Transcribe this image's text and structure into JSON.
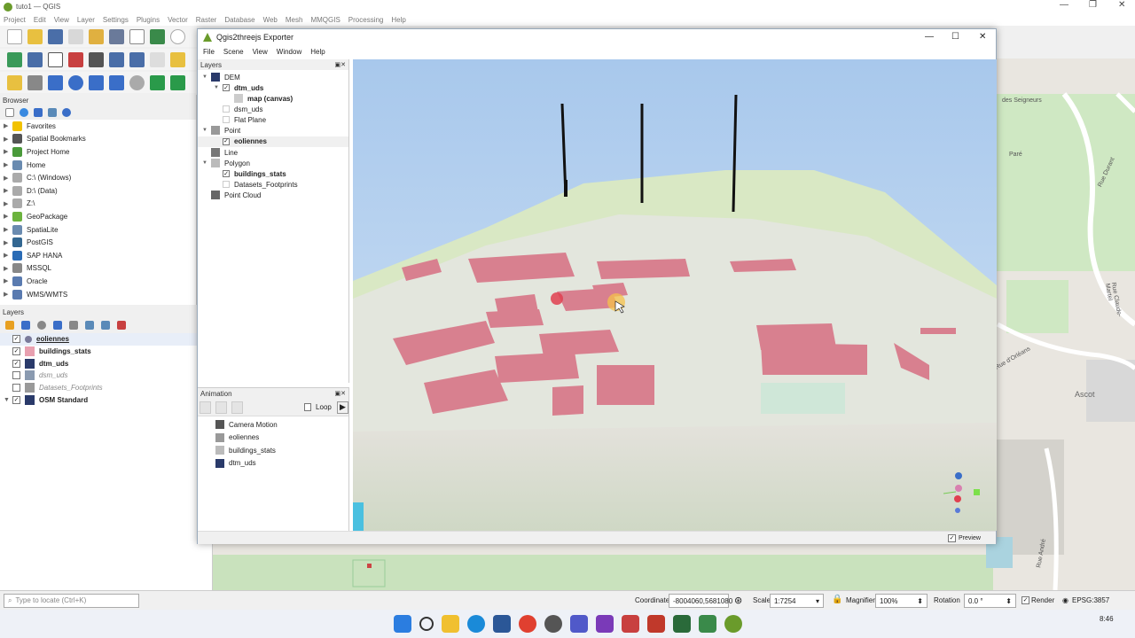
{
  "qgis": {
    "title": "tuto1 — QGIS",
    "menus": [
      "Project",
      "Edit",
      "View",
      "Layer",
      "Settings",
      "Plugins",
      "Vector",
      "Raster",
      "Database",
      "Web",
      "Mesh",
      "MMQGIS",
      "Processing",
      "Help"
    ]
  },
  "browser": {
    "title": "Browser",
    "items": [
      {
        "label": "Favorites",
        "color": "#f2c200"
      },
      {
        "label": "Spatial Bookmarks",
        "color": "#555"
      },
      {
        "label": "Project Home",
        "color": "#4a9a3a"
      },
      {
        "label": "Home",
        "color": "#6a8bb0"
      },
      {
        "label": "C:\\ (Windows)",
        "color": "#aaa"
      },
      {
        "label": "D:\\ (Data)",
        "color": "#aaa"
      },
      {
        "label": "Z:\\",
        "color": "#aaa"
      },
      {
        "label": "GeoPackage",
        "color": "#6cb33e"
      },
      {
        "label": "SpatiaLite",
        "color": "#6a8bb0"
      },
      {
        "label": "PostGIS",
        "color": "#336791"
      },
      {
        "label": "SAP HANA",
        "color": "#2a6bb5"
      },
      {
        "label": "MSSQL",
        "color": "#888"
      },
      {
        "label": "Oracle",
        "color": "#5a7bb0"
      },
      {
        "label": "WMS/WMTS",
        "color": "#5a7bb0"
      }
    ]
  },
  "layers": {
    "title": "Layers",
    "items": [
      {
        "label": "eoliennes",
        "checked": "✓",
        "style": "bold",
        "sym": "#7a7a9a"
      },
      {
        "label": "buildings_stats",
        "checked": "✓",
        "style": "bold",
        "sym": "#e8a0b0"
      },
      {
        "label": "dtm_uds",
        "checked": "✓",
        "style": "bold",
        "sym": "#2a3a6a"
      },
      {
        "label": "dsm_uds",
        "checked": "",
        "style": "italic",
        "sym": "#8a9ab0"
      },
      {
        "label": "Datasets_Footprints",
        "checked": "",
        "style": "italic",
        "sym": "#999"
      },
      {
        "label": "OSM Standard",
        "checked": "✓",
        "style": "bold",
        "sym": "#2a3a6a"
      }
    ]
  },
  "status": {
    "locate_placeholder": "Type to locate (Ctrl+K)",
    "coordinate_label": "Coordinate",
    "coordinate": "-8004060,5681080",
    "scale_label": "Scale",
    "scale": "1:7254",
    "magnifier_label": "Magnifier",
    "magnifier": "100%",
    "rotation_label": "Rotation",
    "rotation": "0.0 °",
    "render_label": "Render",
    "crs": "EPSG:3857",
    "clock": "8:46"
  },
  "map_labels": {
    "seigneurs": "des Seigneurs",
    "durant": "Rue Durant",
    "claude": "Rue Claude-Martel",
    "orleans": "Rue d'Orléans",
    "ascot": "Ascot",
    "andre": "Rue André",
    "pare": "Paré"
  },
  "dialog": {
    "title": "Qgis2threejs Exporter",
    "menus": [
      "File",
      "Scene",
      "View",
      "Window",
      "Help"
    ],
    "layers_title": "Layers",
    "tree": [
      {
        "label": "DEM",
        "indent": 0,
        "arrow": "▼",
        "icon": "dem",
        "cb": false,
        "bold": false
      },
      {
        "label": "dtm_uds",
        "indent": 1,
        "arrow": "▼",
        "icon": "",
        "cb": true,
        "bold": true
      },
      {
        "label": "map (canvas)",
        "indent": 2,
        "arrow": "",
        "icon": "map",
        "cb": false,
        "bold": true
      },
      {
        "label": "dsm_uds",
        "indent": 1,
        "arrow": "",
        "icon": "",
        "cb": "empty",
        "bold": false
      },
      {
        "label": "Flat Plane",
        "indent": 1,
        "arrow": "",
        "icon": "",
        "cb": "empty",
        "bold": false
      },
      {
        "label": "Point",
        "indent": 0,
        "arrow": "▼",
        "icon": "point",
        "cb": false,
        "bold": false
      },
      {
        "label": "eoliennes",
        "indent": 1,
        "arrow": "",
        "icon": "",
        "cb": true,
        "bold": true
      },
      {
        "label": "Line",
        "indent": 0,
        "arrow": "",
        "icon": "line",
        "cb": false,
        "bold": false
      },
      {
        "label": "Polygon",
        "indent": 0,
        "arrow": "▼",
        "icon": "poly",
        "cb": false,
        "bold": false
      },
      {
        "label": "buildings_stats",
        "indent": 1,
        "arrow": "",
        "icon": "",
        "cb": true,
        "bold": true
      },
      {
        "label": "Datasets_Footprints",
        "indent": 1,
        "arrow": "",
        "icon": "",
        "cb": "empty",
        "bold": false
      },
      {
        "label": "Point Cloud",
        "indent": 0,
        "arrow": "",
        "icon": "cloud",
        "cb": false,
        "bold": false
      }
    ],
    "animation_title": "Animation",
    "loop_label": "Loop",
    "anim_items": [
      "Camera Motion",
      "eoliennes",
      "buildings_stats",
      "dtm_uds"
    ],
    "preview_label": "Preview",
    "preview_checked": "✓"
  }
}
